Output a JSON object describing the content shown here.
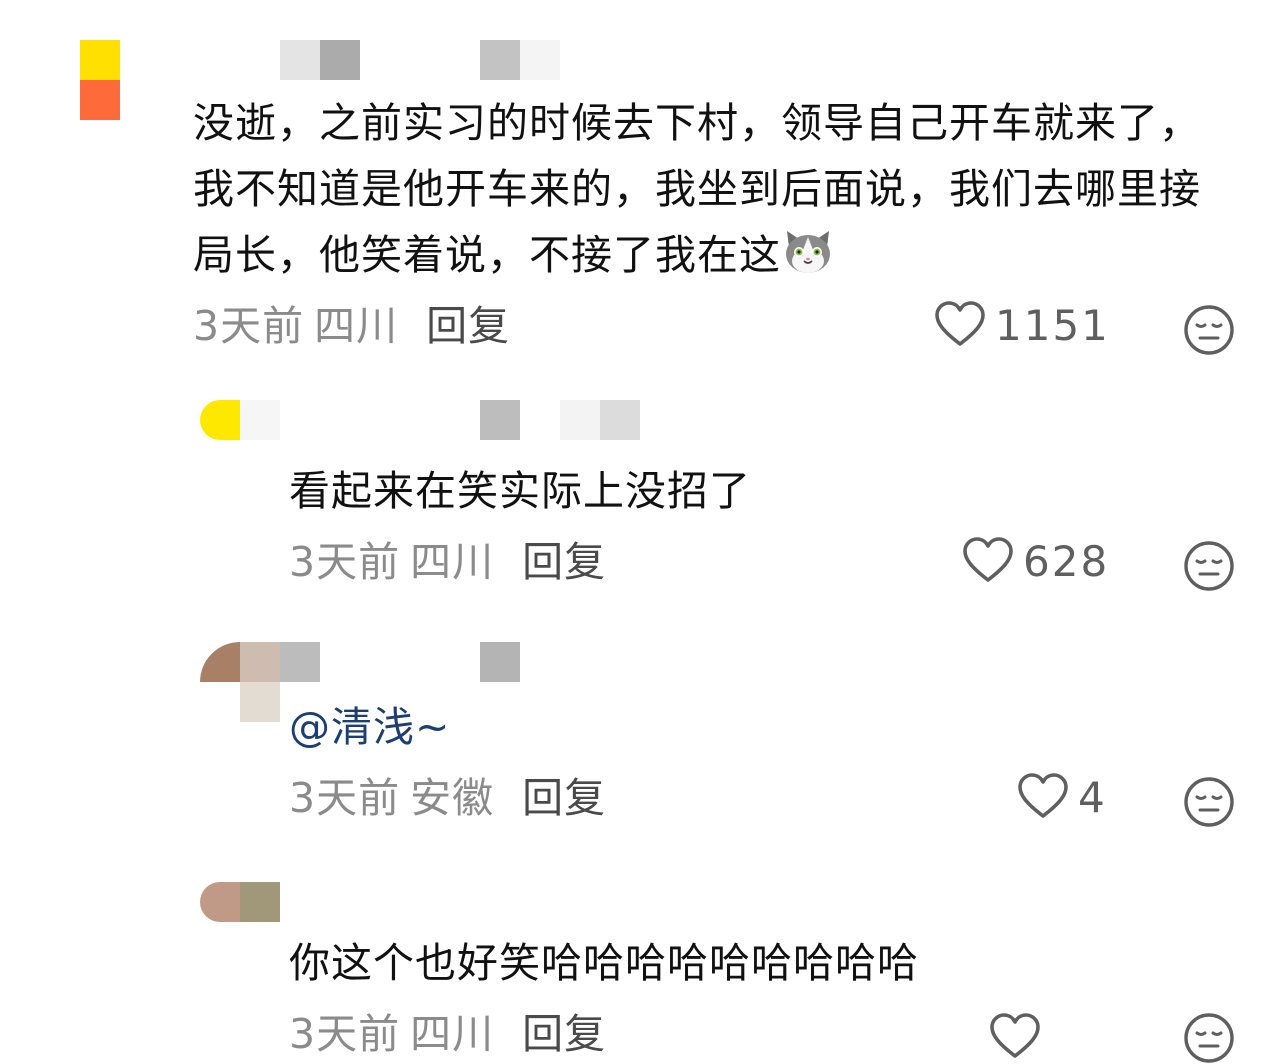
{
  "comments": [
    {
      "text": "没逝，之前实习的时候去下村，领导自己开车就来了，我不知道是他开车来的，我坐到后面说，我们去哪里接局长，他笑着说，不接了我在这",
      "emoji": "cat-face",
      "time": "3天前",
      "region": "四川",
      "reply_label": "回复",
      "likes": "1151"
    },
    {
      "text": "看起来在笑实际上没招了",
      "time": "3天前",
      "region": "四川",
      "reply_label": "回复",
      "likes": "628"
    },
    {
      "text": "@清浅~",
      "time": "3天前",
      "region": "安徽",
      "reply_label": "回复",
      "likes": "4"
    },
    {
      "text": "你这个也好笑哈哈哈哈哈哈哈哈哈",
      "time": "3天前",
      "region": "四川",
      "reply_label": "回复",
      "likes": ""
    }
  ],
  "colors": {
    "meta_gray": "#8b8b8b",
    "reply_gray": "#4a4a4a",
    "mention_blue": "#1c3e72",
    "icon_gray": "#5f5f5f"
  }
}
